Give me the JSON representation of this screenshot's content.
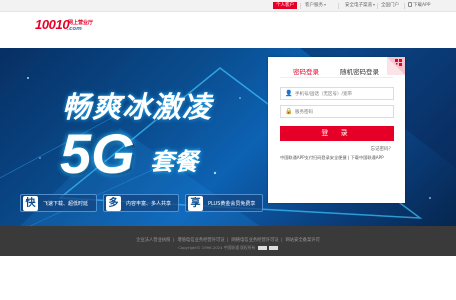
{
  "topbar": {
    "items": [
      {
        "label": "个人客户",
        "active": true
      },
      {
        "label": "客户服务",
        "active": false
      },
      {
        "label": "安全电子渠道",
        "active": false
      },
      {
        "label": "全国门户",
        "active": false
      },
      {
        "label": "下载APP",
        "active": false
      }
    ]
  },
  "logo": {
    "number": "10010",
    "tagline": "网上营业厅",
    "domain": ".com"
  },
  "banner": {
    "slogan": "畅爽冰激凌",
    "highlight": "5G",
    "package": "套餐",
    "features": [
      {
        "char": "快",
        "text": "飞速下载、超低时延"
      },
      {
        "char": "多",
        "text": "内容丰富、多人共享"
      },
      {
        "char": "享",
        "text": "PLUS黄金会员免费享"
      }
    ]
  },
  "login": {
    "tabs": {
      "sms": "密码登录",
      "password": "随机密码登录"
    },
    "phone_placeholder": "手机号/固话（无区号）/宽带",
    "password_placeholder": "服务密码",
    "submit_label": "登 录",
    "forgot_label": "忘记密码？",
    "notice": "中国联通APP支付扫码登录安全便捷 | 下载中国联通APP"
  },
  "footer": {
    "links": [
      "企业法人营业执照",
      "增值电信业务经营许可证",
      "网络电信业务经营许可证",
      "网站安全备案许可"
    ],
    "copyright": "Copyright© 1999-2024 中国联通 版权所有"
  },
  "colors": {
    "brand_red": "#e60027",
    "banner_blue": "#0a4d8f",
    "footer_bg": "#3a3a3a"
  }
}
